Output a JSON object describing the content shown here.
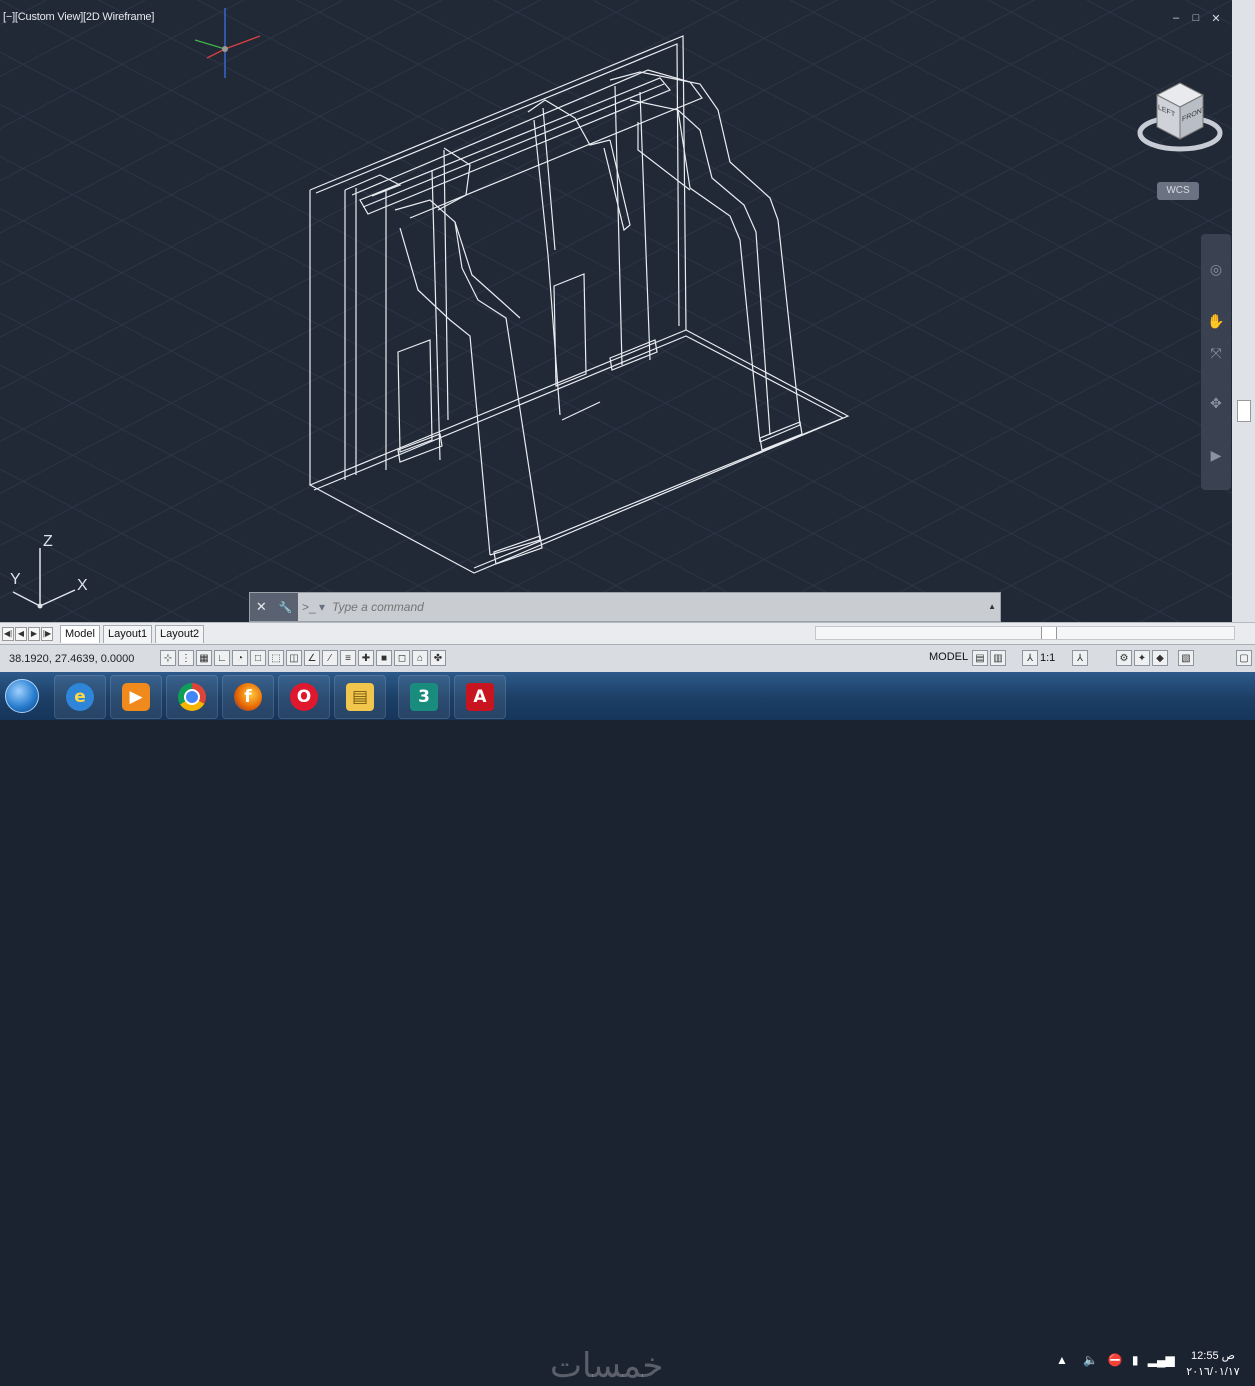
{
  "viewport": {
    "label": "[−][Custom View][2D Wireframe]",
    "controls": [
      "‒",
      "□",
      "✕"
    ],
    "viewcube": {
      "top_face": "",
      "front_face": "LEFT",
      "right_face": "FRONT"
    },
    "wcs_label": "WCS",
    "ucs": {
      "z": "Z",
      "y": "Y",
      "x": "X"
    }
  },
  "command_line": {
    "placeholder": "Type a command",
    "prompt": ">_ ▾",
    "close": "✕",
    "settings": "🔧"
  },
  "layout_tabs": {
    "nav": [
      "◀|",
      "◀",
      "▶",
      "|▶"
    ],
    "tabs": [
      "Model",
      "Layout1",
      "Layout2"
    ],
    "active": "Model"
  },
  "status_bar": {
    "coordinates": "38.1920, 27.4639, 0.0000",
    "model_label": "MODEL",
    "scale": "1:1"
  },
  "taskbar": {
    "apps": [
      "windows-explorer",
      "internet-explorer",
      "media-player",
      "chrome",
      "firefox",
      "opera",
      "file-manager",
      "autodesk-3ds",
      "autocad"
    ],
    "watermark": "خمسات",
    "clock_time": "12:55 ص",
    "clock_date": "٢٠١٦/٠١/١٧"
  },
  "colors": {
    "viewport_bg": "#212836",
    "wireframe": "#ffffff",
    "grid": "#2e3646"
  }
}
